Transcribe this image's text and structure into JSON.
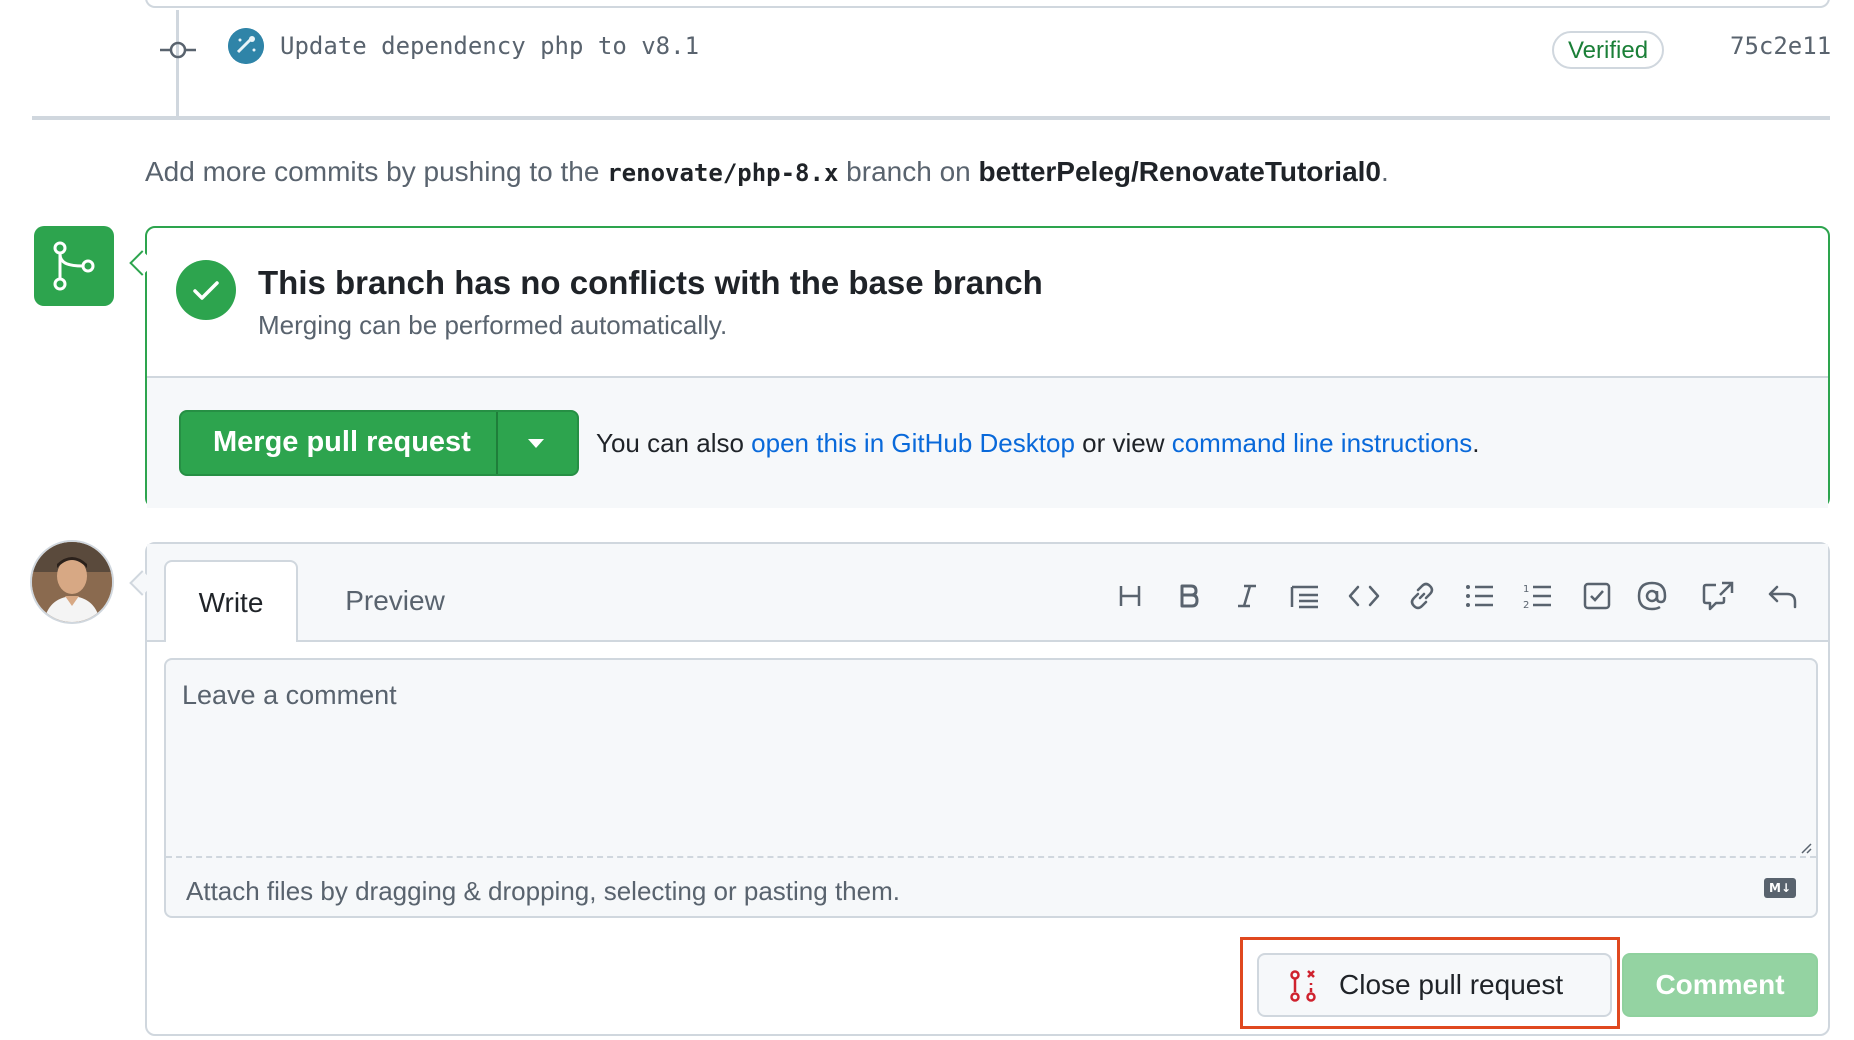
{
  "commit": {
    "message": "Update dependency php to v8.1",
    "verified_label": "Verified",
    "sha": "75c2e11",
    "avatar_icon": "renovate-bot-avatar",
    "commit_icon": "git-commit-icon"
  },
  "push_hint": {
    "prefix": "Add more commits by pushing to the ",
    "branch": "renovate/php-8.x",
    "middle": " branch on ",
    "repo": "betterPeleg/RenovateTutorial0",
    "suffix": "."
  },
  "merge": {
    "badge_icon": "git-merge-icon",
    "status_icon": "check-icon",
    "title": "This branch has no conflicts with the base branch",
    "subtitle": "Merging can be performed automatically.",
    "button_label": "Merge pull request",
    "dropdown_icon": "triangle-down-icon",
    "also_prefix": "You can also ",
    "desktop_link": "open this in GitHub Desktop",
    "also_middle": " or view ",
    "cli_link": "command line instructions",
    "also_suffix": ".",
    "accent_color": "#2da44e"
  },
  "comment": {
    "tabs": [
      "Write",
      "Preview"
    ],
    "active_tab": "Write",
    "toolbar_icons": [
      "heading-icon",
      "bold-icon",
      "italic-icon",
      "quote-icon",
      "code-icon",
      "link-icon",
      "unordered-list-icon",
      "ordered-list-icon",
      "tasklist-icon",
      "mention-icon",
      "cross-reference-icon",
      "reply-icon"
    ],
    "placeholder": "Leave a comment",
    "attach_hint": "Attach files by dragging & dropping, selecting or pasting them.",
    "markdown_icon": "markdown-icon",
    "close_button_label": "Close pull request",
    "close_icon": "git-pull-request-closed-icon",
    "comment_button_label": "Comment",
    "highlight_color": "#e0481f"
  }
}
